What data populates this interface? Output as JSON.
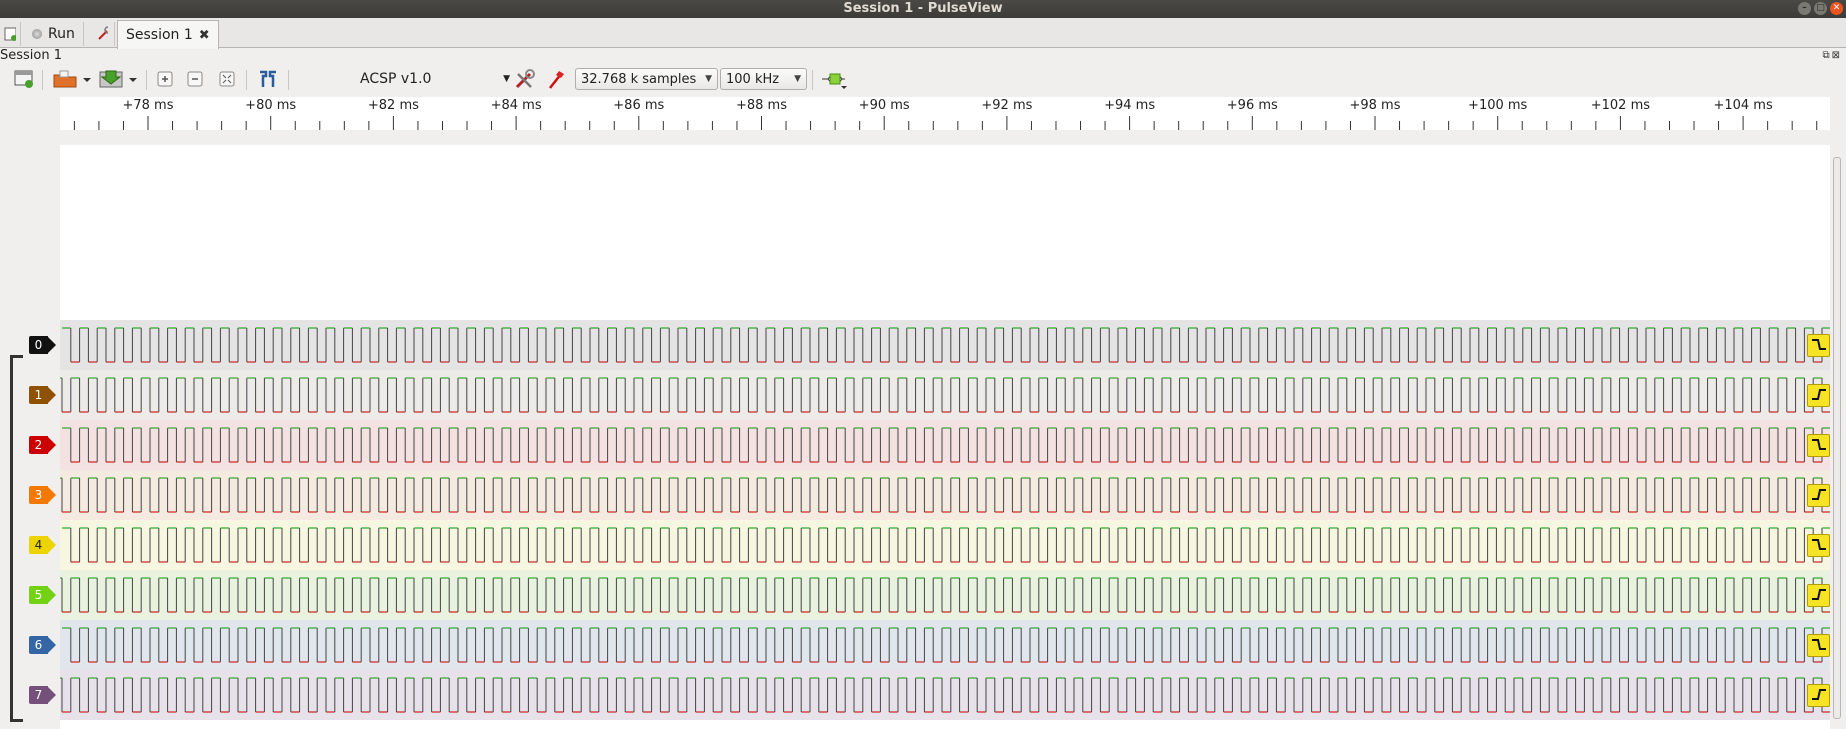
{
  "window": {
    "title": "Session 1 - PulseView"
  },
  "tabs": {
    "run_label": "Run",
    "session_label": "Session 1"
  },
  "dock": {
    "title": "Session 1"
  },
  "toolbar": {
    "device": "ACSP v1.0",
    "samples": "32.768 k samples",
    "samplerate": "100 kHz"
  },
  "ruler": {
    "ticks": [
      "+78 ms",
      "+80 ms",
      "+82 ms",
      "+84 ms",
      "+86 ms",
      "+88 ms",
      "+90 ms",
      "+92 ms",
      "+94 ms",
      "+96 ms",
      "+98 ms",
      "+100 ms",
      "+102 ms",
      "+104 ms"
    ]
  },
  "channels": [
    {
      "name": "0",
      "color": "#111111",
      "bg": "#e4e4e4",
      "trigger": "falling"
    },
    {
      "name": "1",
      "color": "#8f5202",
      "bg": "#ecebe8",
      "trigger": "rising"
    },
    {
      "name": "2",
      "color": "#cc0000",
      "bg": "#f4e2e2",
      "trigger": "falling"
    },
    {
      "name": "3",
      "color": "#f57900",
      "bg": "#f5eadf",
      "trigger": "rising"
    },
    {
      "name": "4",
      "color": "#edd400",
      "bg": "#f7f6e0",
      "trigger": "falling"
    },
    {
      "name": "5",
      "color": "#73d216",
      "bg": "#e8f2de",
      "trigger": "rising"
    },
    {
      "name": "6",
      "color": "#3465a4",
      "bg": "#e1e6ed",
      "trigger": "falling"
    },
    {
      "name": "7",
      "color": "#75507b",
      "bg": "#e7e2ea",
      "trigger": "rising"
    }
  ],
  "colors": {
    "signal_high": "#2ea82e",
    "signal_low": "#cc2222",
    "trigger_bg": "#f6e324"
  }
}
